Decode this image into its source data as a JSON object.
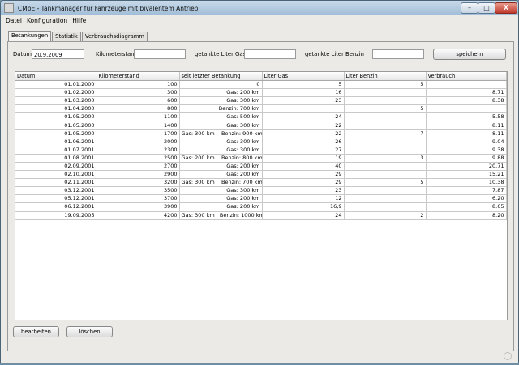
{
  "window": {
    "title": "CMbE - Tankmanager für Fahrzeuge mit bivalentem Antrieb",
    "minimize": "–",
    "maximize": "□",
    "close": "X"
  },
  "menu": [
    "Datei",
    "Konfiguration",
    "Hilfe"
  ],
  "tabs": [
    "Betankungen",
    "Statistik",
    "Verbrauchsdiagramm"
  ],
  "form": {
    "datum_label": "Datum",
    "datum_value": "20.9.2009",
    "km_label": "Kilometerstand",
    "km_value": "",
    "gas_label": "getankte Liter Gas",
    "gas_value": "",
    "benzin_label": "getankte Liter Benzin",
    "benzin_value": "",
    "save_label": "speichern"
  },
  "table": {
    "columns": [
      "Datum",
      "Kilometerstand",
      "seit letzter Betankung",
      "Liter Gas",
      "Liter Benzin",
      "Verbrauch"
    ],
    "rows": [
      [
        "01.01.2000",
        "100",
        "0",
        "5",
        "5",
        ""
      ],
      [
        "01.02.2000",
        "300",
        "Gas: 200 km",
        "16",
        "",
        "8.71"
      ],
      [
        "01.03.2000",
        "600",
        "Gas: 300 km",
        "23",
        "",
        "8.38"
      ],
      [
        "01.04.2000",
        "800",
        "Benzin: 700 km",
        "",
        "5",
        ""
      ],
      [
        "01.05.2000",
        "1100",
        "Gas: 500 km",
        "24",
        "",
        "5.58"
      ],
      [
        "01.05.2000",
        "1400",
        "Gas: 300 km",
        "22",
        "",
        "8.11"
      ],
      [
        "01.05.2000",
        "1700",
        "Gas: 300 km    Benzin: 900 km",
        "22",
        "7",
        "8.11"
      ],
      [
        "01.06.2001",
        "2000",
        "Gas: 300 km",
        "26",
        "",
        "9.04"
      ],
      [
        "01.07.2001",
        "2300",
        "Gas: 300 km",
        "27",
        "",
        "9.38"
      ],
      [
        "01.08.2001",
        "2500",
        "Gas: 200 km    Benzin: 800 km",
        "19",
        "3",
        "9.88"
      ],
      [
        "02.09.2001",
        "2700",
        "Gas: 200 km",
        "40",
        "",
        "20.71"
      ],
      [
        "02.10.2001",
        "2900",
        "Gas: 200 km",
        "29",
        "",
        "15.21"
      ],
      [
        "02.11.2001",
        "3200",
        "Gas: 300 km    Benzin: 700 km",
        "29",
        "5",
        "10.38"
      ],
      [
        "03.12.2001",
        "3500",
        "Gas: 300 km",
        "23",
        "",
        "7.87"
      ],
      [
        "05.12.2001",
        "3700",
        "Gas: 200 km",
        "12",
        "",
        "6.20"
      ],
      [
        "06.12.2001",
        "3900",
        "Gas: 200 km",
        "16,9",
        "",
        "8.65"
      ],
      [
        "19.09.2005",
        "4200",
        "Gas: 300 km   Benzin: 1000 km",
        "24",
        "2",
        "8.20"
      ]
    ]
  },
  "actions": {
    "edit_label": "bearbeiten",
    "delete_label": "löschen"
  }
}
